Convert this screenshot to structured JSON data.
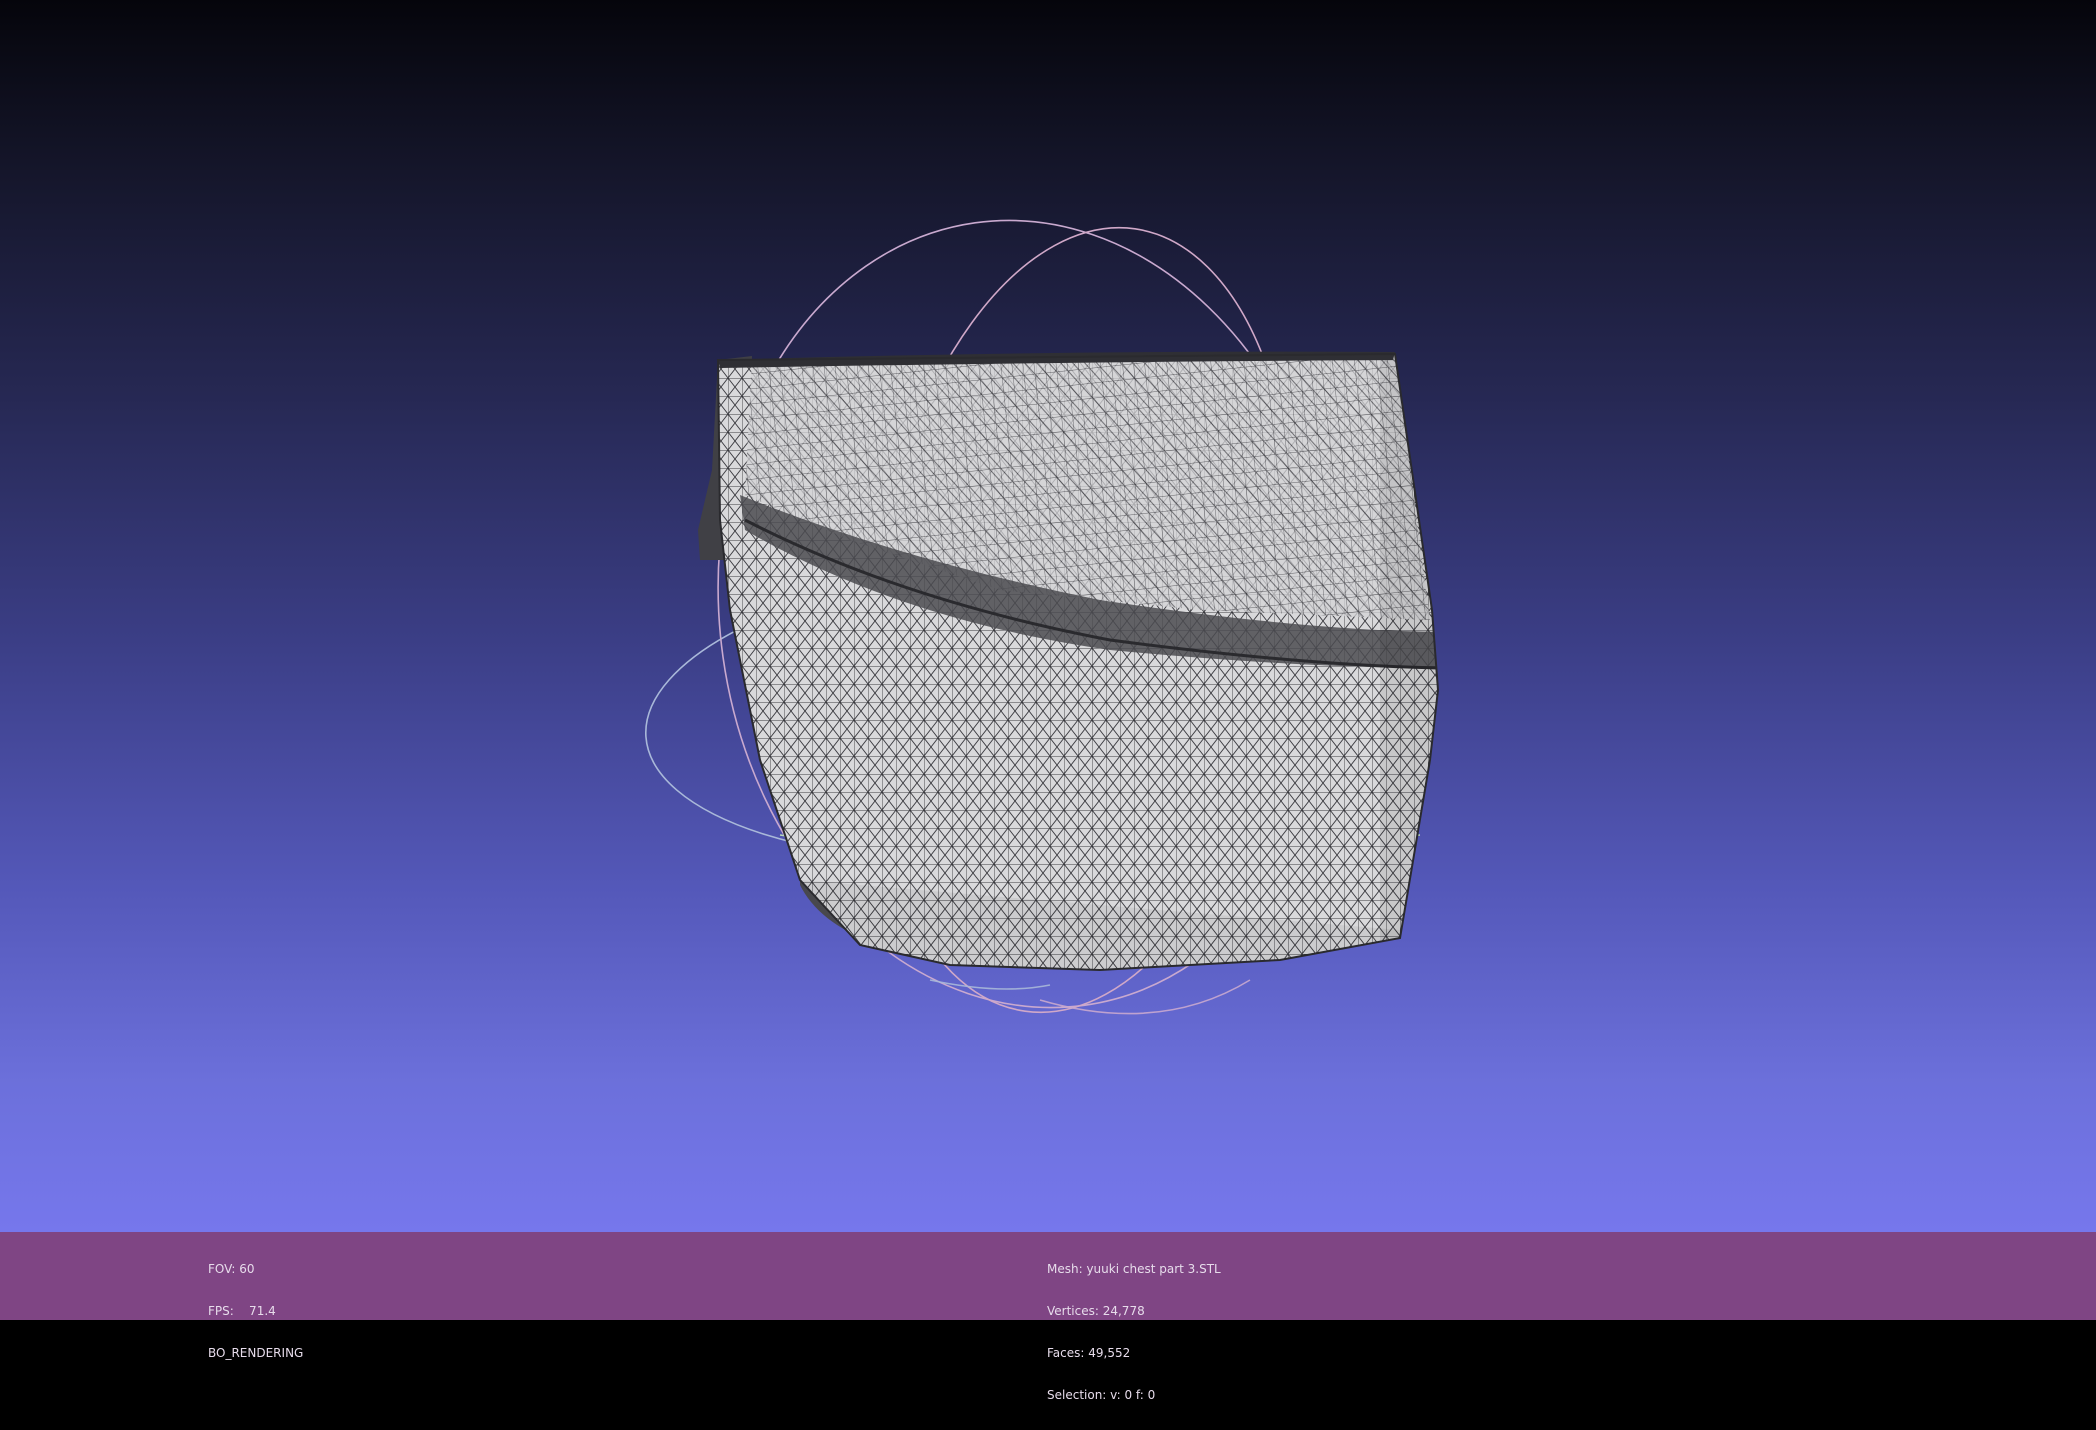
{
  "window": {
    "colors": {
      "background_top": "#05050b",
      "background_bottom": "#7677ec",
      "statusbar": "#7f4584",
      "mesh_fill": "#d9d9db",
      "mesh_wire": "#2a2a2e",
      "trackball_a": "#c9a9cf",
      "trackball_b": "#a9b8d9",
      "trackball_c": "#b8d9b8"
    }
  },
  "viewport": {
    "mesh_icon": "wireframe-mesh",
    "trackball_icon": "trackball-rings"
  },
  "status_left": {
    "fov": "FOV: 60",
    "fps": "FPS:    71.4",
    "render_mode": "BO_RENDERING"
  },
  "status_center": {
    "mesh": "Mesh: yuuki chest part 3.STL",
    "vertices": "Vertices: 24,778",
    "faces": "Faces: 49,552",
    "selection": "Selection: v: 0 f: 0"
  }
}
